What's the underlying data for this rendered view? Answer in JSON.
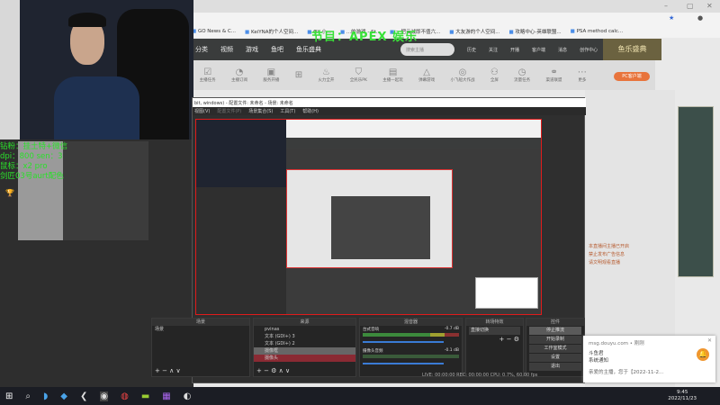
{
  "browser": {
    "bookmarks": [
      "GO News & C...",
      "KeiYNA的个人空间...",
      "QY-小...",
      "...的游戏 - St...",
      "一把云战即不值六...",
      "大友游的个人空间...",
      "攻略中心-英雄联盟...",
      "PSA method calc..."
    ]
  },
  "douyu": {
    "nav": [
      "分类",
      "视频",
      "游戏",
      "鱼吧",
      "鱼乐盛典"
    ],
    "search_placeholder": "搜索主播",
    "nav_icons": [
      "历史",
      "关注",
      "开播",
      "客户端",
      "消息",
      "创作中心"
    ],
    "banner": "鱼乐盛典",
    "icon_row": [
      "主播任务",
      "主播订阅",
      "服务开播",
      "",
      "火力全开",
      "全民乐PK",
      "主播一起玩",
      "弹幕游戏",
      "小飞船大作战",
      "全屏",
      "流量任务",
      "渠道联盟",
      "更多"
    ],
    "pc_button": "PC客户端",
    "side_text": [
      "本直播间主播已开启",
      "禁止发布广告信息",
      "请文明观看直播"
    ]
  },
  "overlay": {
    "title": "节目：APEX 娱乐",
    "lines": [
      "钻粉：挂土特+微信",
      "dpi：800 sen：3",
      "鼠标：x2 pro",
      "剑匠03号aurt配色"
    ]
  },
  "obs": {
    "title": "bit, windows) - 配置文件: 未命名 - 场景: 未命名",
    "menu": [
      "文件(F)",
      "编辑(E)",
      "视图(V)",
      "配置文件(P)",
      "场景集合(S)",
      "工具(T)",
      "帮助(H)"
    ],
    "docks": {
      "scenes": {
        "header": "场景",
        "items": [
          "场景"
        ]
      },
      "sources": {
        "header": "来源",
        "items": [
          "pvinas",
          "文本 (GDI+) 3",
          "文本 (GDI+) 2",
          "摄像框",
          "摄像头"
        ]
      },
      "mixer": {
        "header": "混音器",
        "channels": [
          {
            "name": "台式音响",
            "db": "-0.7 dB"
          },
          {
            "name": "摄像头音频",
            "db": "-0.1 dB"
          }
        ]
      },
      "transitions": {
        "header": "转场特效",
        "value": "直接切换"
      },
      "controls": {
        "header": "控件",
        "buttons": [
          "停止推流",
          "开始录制",
          "工作室模式",
          "设置",
          "退出"
        ]
      }
    },
    "status": "LIVE: 00:00:00   REC: 00:00:00   CPU: 0.7%, 60.00 fps"
  },
  "notification": {
    "source": "msg.douyu.com • 刚刚",
    "title": "斗鱼君",
    "subtitle": "系统通知",
    "body": "亲爱的主播，您于【2022-11-2..."
  },
  "taskbar": {
    "time": "9:45",
    "date": "2022/11/23"
  }
}
